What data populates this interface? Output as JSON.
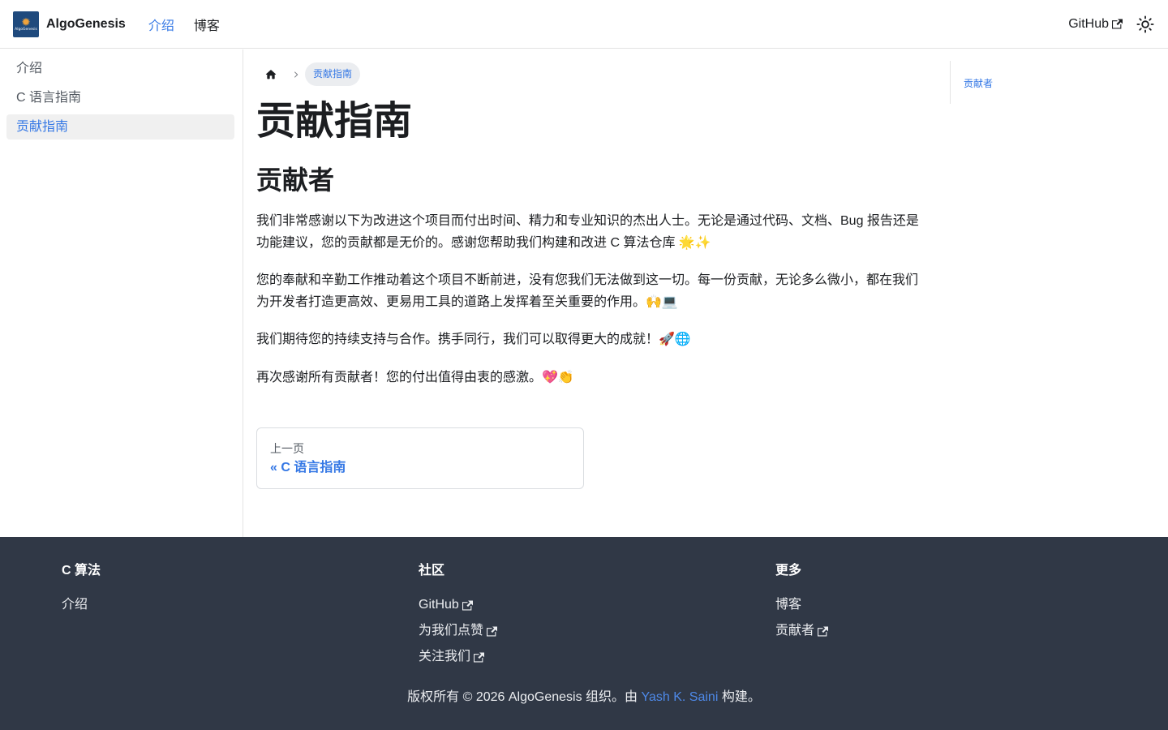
{
  "navbar": {
    "brand_title": "AlgoGenesis",
    "logo_text": "AlgoGenesis",
    "items": [
      {
        "label": "介绍",
        "active": true
      },
      {
        "label": "博客",
        "active": false
      }
    ],
    "github_label": "GitHub",
    "theme_icon": "sun-icon"
  },
  "sidebar": {
    "items": [
      {
        "label": "介绍"
      },
      {
        "label": "C 语言指南"
      },
      {
        "label": "贡献指南"
      }
    ]
  },
  "breadcrumb": {
    "home_icon": "home-icon",
    "current": "贡献指南"
  },
  "main": {
    "title": "贡献指南",
    "section_title": "贡献者",
    "paragraphs": [
      "我们非常感谢以下为改进这个项目而付出时间、精力和专业知识的杰出人士。无论是通过代码、文档、Bug 报告还是功能建议，您的贡献都是无价的。感谢您帮助我们构建和改进 C 算法仓库 🌟✨",
      "您的奉献和辛勤工作推动着这个项目不断前进，没有您我们无法做到这一切。每一份贡献，无论多么微小，都在我们为开发者打造更高效、更易用工具的道路上发挥着至关重要的作用。🙌💻",
      "我们期待您的持续支持与合作。携手同行，我们可以取得更大的成就！🚀🌐",
      "再次感谢所有贡献者！您的付出值得由衷的感激。💖👏"
    ]
  },
  "pager": {
    "sub_label": "上一页",
    "label": "« C 语言指南"
  },
  "toc": {
    "items": [
      {
        "label": "贡献者"
      }
    ]
  },
  "footer": {
    "columns": [
      {
        "title": "C 算法",
        "links": [
          {
            "label": "介绍",
            "external": false
          }
        ]
      },
      {
        "title": "社区",
        "links": [
          {
            "label": "GitHub",
            "external": true
          },
          {
            "label": "为我们点赞",
            "external": true
          },
          {
            "label": "关注我们",
            "external": true
          }
        ]
      },
      {
        "title": "更多",
        "links": [
          {
            "label": "博客",
            "external": false
          },
          {
            "label": "贡献者",
            "external": true
          }
        ]
      }
    ],
    "copyright_prefix": "版权所有 © 2026 AlgoGenesis 组织。由 ",
    "copyright_author": "Yash K. Saini",
    "copyright_suffix": " 构建。"
  },
  "colors": {
    "accent": "#3578e5",
    "footer_bg": "#303846",
    "active_bg": "#f0f0f0"
  }
}
